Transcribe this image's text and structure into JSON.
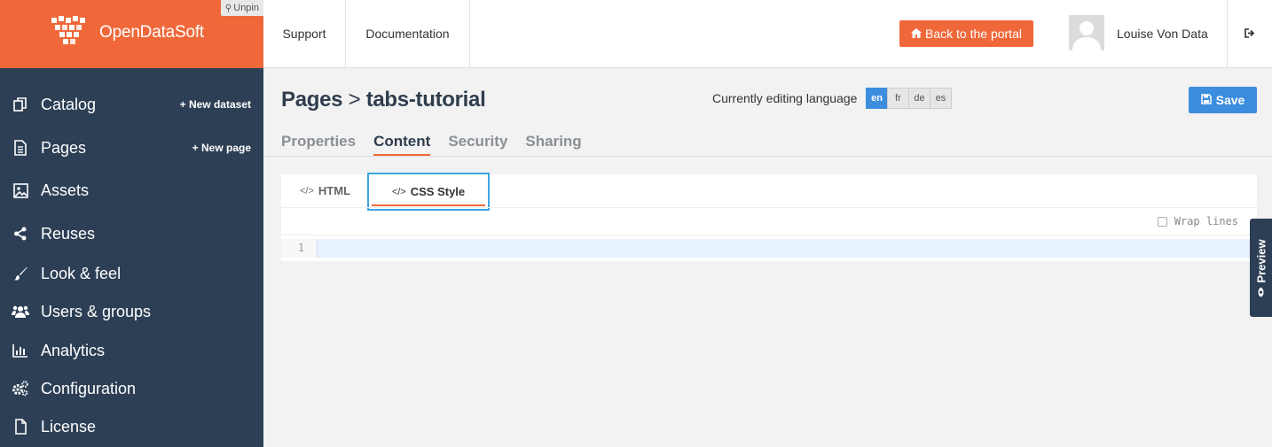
{
  "brand": {
    "name": "OpenDataSoft",
    "unpin_label": "Unpin",
    "color": "#f0683a"
  },
  "sidebar": {
    "background": "#2d3f55",
    "items": [
      {
        "label": "Catalog",
        "icon": "catalog-icon",
        "action": "New dataset"
      },
      {
        "label": "Pages",
        "icon": "page-icon",
        "action": "New page"
      },
      {
        "label": "Assets",
        "icon": "image-icon"
      },
      {
        "label": "Reuses",
        "icon": "share-icon"
      },
      {
        "label": "Look & feel",
        "icon": "brush-icon"
      },
      {
        "label": "Users & groups",
        "icon": "users-icon"
      },
      {
        "label": "Analytics",
        "icon": "bar-chart-icon"
      },
      {
        "label": "Configuration",
        "icon": "cogs-icon"
      },
      {
        "label": "License",
        "icon": "file-icon"
      }
    ]
  },
  "topbar": {
    "links": [
      "Support",
      "Documentation"
    ],
    "back_button": "Back to the portal",
    "user_name": "Louise Von Data"
  },
  "page": {
    "breadcrumb_parent": "Pages",
    "breadcrumb_sep": ">",
    "breadcrumb_current": "tabs-tutorial",
    "language_label": "Currently editing language",
    "languages": [
      "en",
      "fr",
      "de",
      "es"
    ],
    "active_language": "en",
    "save_label": "Save",
    "tabs": [
      "Properties",
      "Content",
      "Security",
      "Sharing"
    ],
    "active_tab": "Content"
  },
  "editor": {
    "tabs": [
      "HTML",
      "CSS Style"
    ],
    "active_tab": "CSS Style",
    "wrap_label": "Wrap lines",
    "wrap_checked": false,
    "line_numbers": [
      "1"
    ]
  },
  "preview_label": "Preview",
  "colors": {
    "accent": "#f0683a",
    "primary": "#3c8dde",
    "focus": "#3ba6e3"
  }
}
